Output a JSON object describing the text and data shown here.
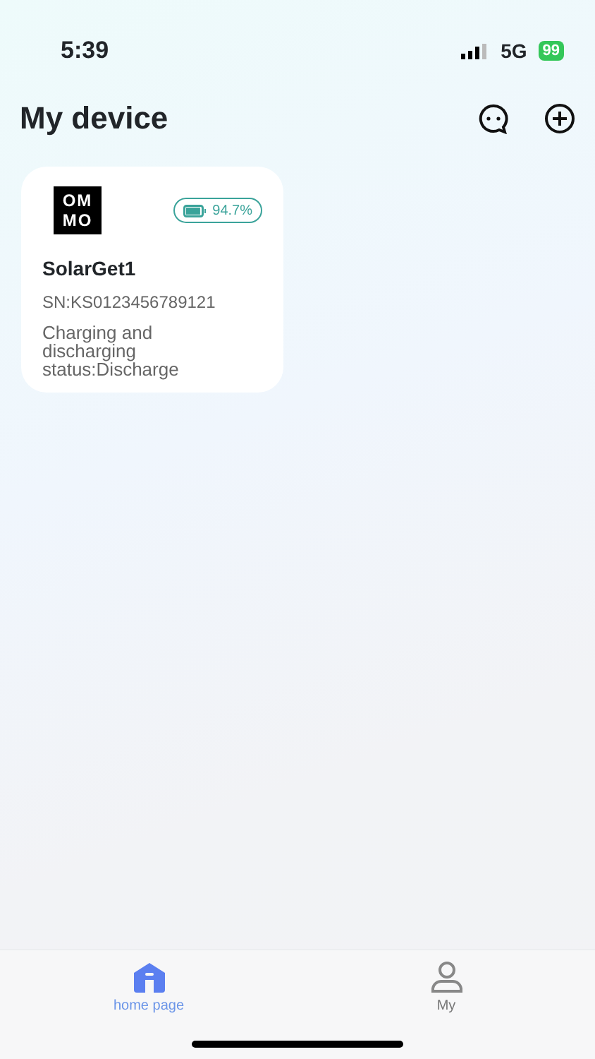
{
  "status_bar": {
    "time": "5:39",
    "network": "5G",
    "battery": "99"
  },
  "header": {
    "title": "My device"
  },
  "devices": [
    {
      "logo_lines": [
        "OM",
        "MO"
      ],
      "level": 0.947,
      "battery_text": "94.7%",
      "name": "SolarGet1",
      "serial": "SN:KS0123456789121",
      "status": "Charging and discharging status:Discharge"
    }
  ],
  "tabs": [
    {
      "label": "home page",
      "kind": "home",
      "selected": true
    },
    {
      "label": "My",
      "kind": "person",
      "selected": false
    }
  ]
}
